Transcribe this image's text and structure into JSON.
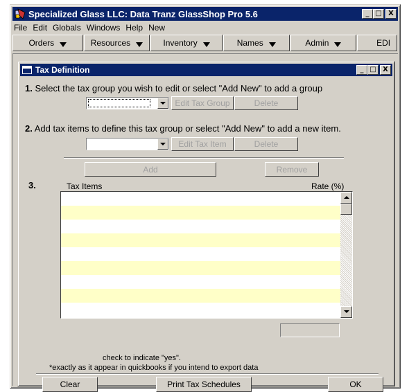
{
  "app": {
    "title": "Specialized Glass LLC: Data Tranz GlassShop Pro 5.6",
    "window_buttons": [
      "_",
      "□",
      "X"
    ]
  },
  "menu": [
    "File",
    "Edit",
    "Globals",
    "Windows",
    "Help",
    "New"
  ],
  "toolbar": [
    "Orders",
    "Resources",
    "Inventory",
    "Names",
    "Admin",
    "EDI"
  ],
  "dialog": {
    "title": "Tax Definition",
    "step1": {
      "number": "1.",
      "text": "Select the tax group you wish to edit or select \"Add New\" to add a group",
      "combo_value": "",
      "edit_button": "Edit Tax Group",
      "delete_button": "Delete"
    },
    "step2": {
      "number": "2.",
      "text": "Add tax items to define this tax group or select \"Add New\" to add a new item.",
      "combo_value": "",
      "edit_button": "Edit Tax Item",
      "delete_button": "Delete"
    },
    "add_button": "Add",
    "remove_button": "Remove",
    "step3": {
      "number": "3.",
      "col_items": "Tax Items",
      "col_rate": "Rate (%)"
    },
    "notes": {
      "line1": "check to indicate \"yes\".",
      "line2": "*exactly as it appear in quickbooks if you intend to export data"
    },
    "footer": {
      "clear": "Clear",
      "print": "Print Tax Schedules",
      "ok": "OK"
    }
  },
  "colors": {
    "titlebar": "#0a246a",
    "face": "#d4d0c8",
    "row_alt": "#ffffc8"
  }
}
